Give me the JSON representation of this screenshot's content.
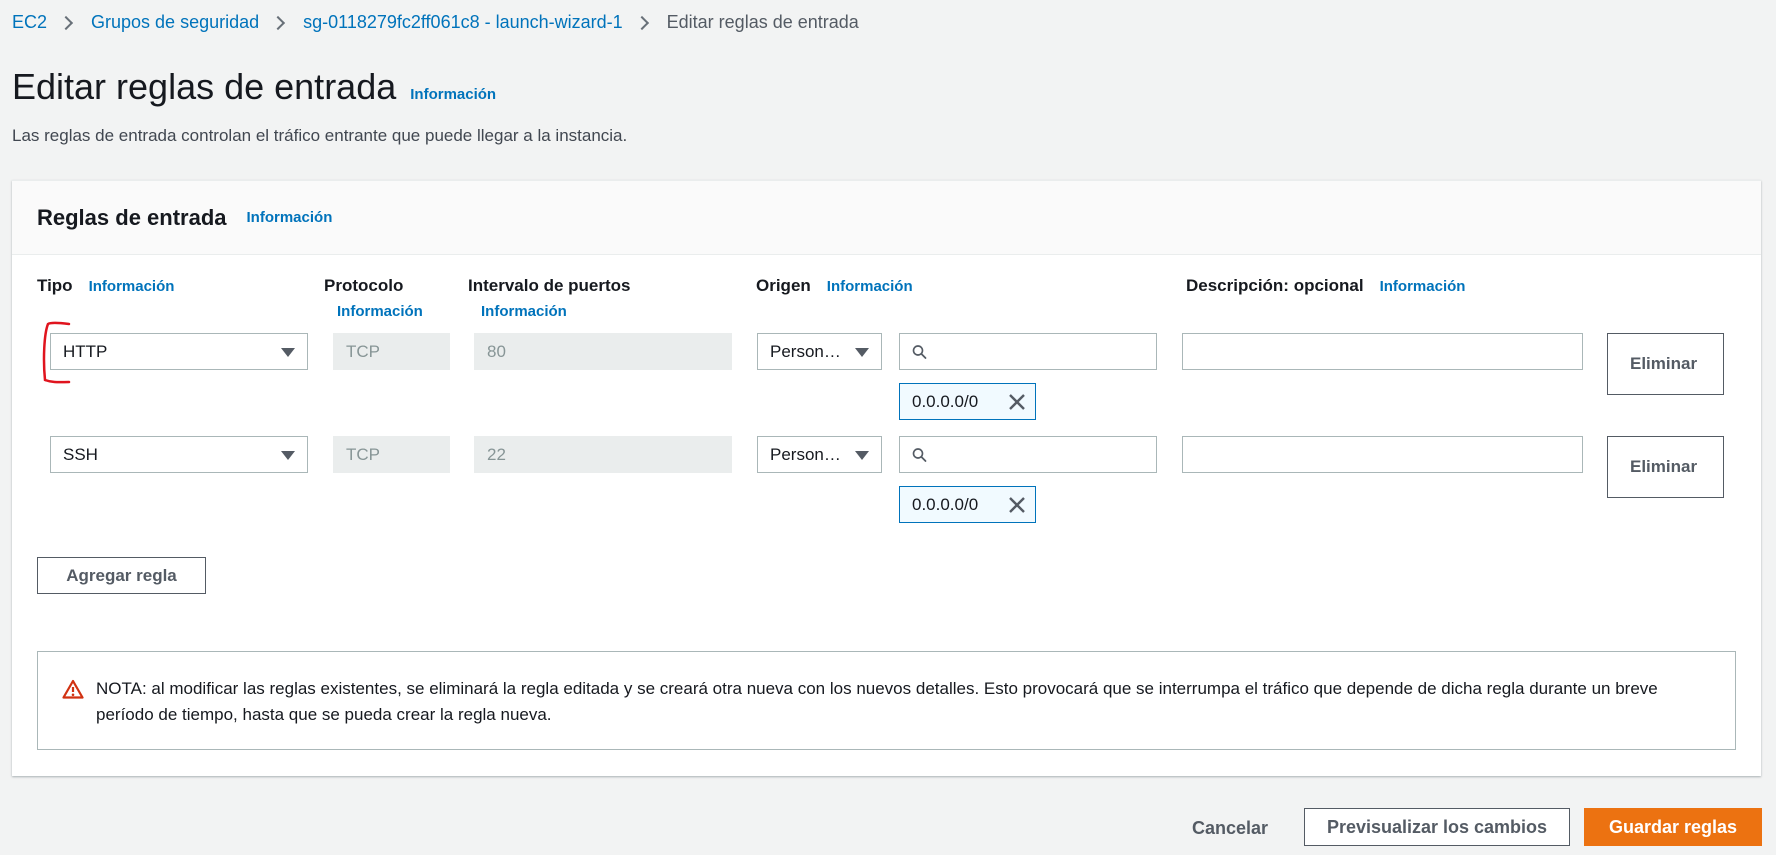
{
  "breadcrumb": {
    "items": [
      "EC2",
      "Grupos de seguridad",
      "sg-0118279fc2ff061c8 - launch-wizard-1"
    ],
    "current": "Editar reglas de entrada"
  },
  "page": {
    "title": "Editar reglas de entrada",
    "info": "Información",
    "description": "Las reglas de entrada controlan el tráfico entrante que puede llegar a la instancia."
  },
  "panel": {
    "title": "Reglas de entrada",
    "info": "Información"
  },
  "columns": {
    "tipo": "Tipo",
    "protocolo": "Protocolo",
    "intervalo": "Intervalo de puertos",
    "origen": "Origen",
    "descripcion": "Descripción: opcional",
    "info": "Información"
  },
  "rules": [
    {
      "type": "HTTP",
      "protocol": "TCP",
      "port": "80",
      "source": "Person…",
      "search_value": "",
      "cidr": "0.0.0.0/0",
      "description": "",
      "remove": "Eliminar"
    },
    {
      "type": "SSH",
      "protocol": "TCP",
      "port": "22",
      "source": "Person…",
      "search_value": "",
      "cidr": "0.0.0.0/0",
      "description": "",
      "remove": "Eliminar"
    }
  ],
  "add_rule": "Agregar regla",
  "note": "NOTA: al modificar las reglas existentes, se eliminará la regla editada y se creará otra nueva con los nuevos detalles. Esto provocará que se interrumpa el tráfico que depende de dicha regla durante un breve período de tiempo, hasta que se pueda crear la regla nueva.",
  "footer": {
    "cancel": "Cancelar",
    "preview": "Previsualizar los cambios",
    "save": "Guardar reglas"
  },
  "colors": {
    "link": "#0073bb",
    "primary": "#ec7211",
    "warning": "#d13212",
    "annotation": "#e0141e"
  }
}
